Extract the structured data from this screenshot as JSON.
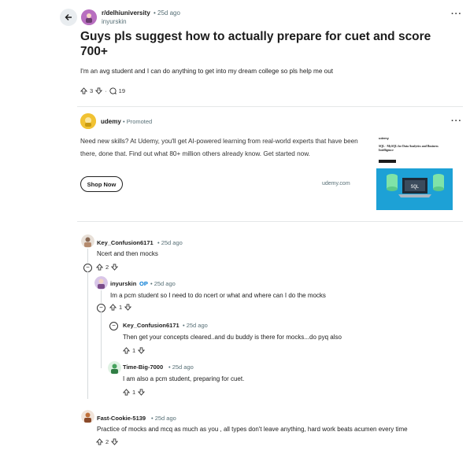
{
  "post": {
    "subreddit": "r/delhiuniversity",
    "time": "• 25d ago",
    "author": "inyurskin",
    "title": "Guys pls suggest how to actually prepare for cuet and score 700+",
    "body": "I'm an avg student and I can do anything to get into my dream college so pls help me out",
    "votes": "3",
    "separator": "·",
    "comments": "19"
  },
  "ad": {
    "advertiser": "udemy",
    "promoted": "• Promoted",
    "text": "Need new skills? At Udemy, you'll get AI-powered learning from real-world experts that have been there, done that. Find out what 80+ million others already know. Get started now.",
    "button": "Shop Now",
    "domain": "udemy.com",
    "image_logo": "udemy",
    "image_title": "SQL - MySQL for Data Analytics and Business Intelligence"
  },
  "comments": [
    {
      "author": "Key_Confusion6171",
      "time": "• 25d ago",
      "text": "Ncert and then mocks",
      "votes": "2"
    },
    {
      "author": "inyurskin",
      "op": "OP",
      "time": "• 25d ago",
      "text": "Im a pcm student so I need to do ncert or what and where can I do the mocks",
      "votes": "1"
    },
    {
      "author": "Key_Confusion6171",
      "time": "• 25d ago",
      "text": "Then get your concepts cleared..and du buddy is there for mocks...do pyq also",
      "votes": "1"
    },
    {
      "author": "Time-Big-7000",
      "time": "• 25d ago",
      "text": "I am also a pcm student, preparing for cuet.",
      "votes": "1"
    },
    {
      "author": "Fast-Cookie-5139",
      "time": "• 25d ago",
      "text": "Practice of mocks and mcq as much as you , all types don't leave anything, hard work beats acumen every time",
      "votes": "2"
    }
  ],
  "icons": {
    "back": "arrow-left-icon",
    "more": "more-dots-icon",
    "upvote": "upvote-icon",
    "downvote": "downvote-icon",
    "comment": "comment-icon",
    "collapse": "collapse-icon"
  },
  "colors": {
    "op_badge": "#0079d3",
    "subreddit_avatar": "#b86fc0",
    "udemy_avatar": "#f1c232",
    "ad_image_blue": "#1da1d6"
  }
}
